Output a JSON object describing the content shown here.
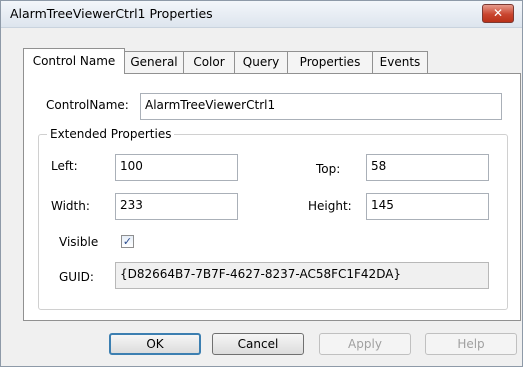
{
  "window": {
    "title": "AlarmTreeViewerCtrl1 Properties",
    "close_label": "✕"
  },
  "tabs": [
    {
      "label": "Control Name"
    },
    {
      "label": "General"
    },
    {
      "label": "Color"
    },
    {
      "label": "Query"
    },
    {
      "label": "Properties"
    },
    {
      "label": "Events"
    }
  ],
  "form": {
    "control_name_label": "ControlName:",
    "control_name_value": "AlarmTreeViewerCtrl1",
    "group_title": "Extended Properties",
    "left_label": "Left:",
    "left_value": "100",
    "top_label": "Top:",
    "top_value": "58",
    "width_label": "Width:",
    "width_value": "233",
    "height_label": "Height:",
    "height_value": "145",
    "visible_label": "Visible",
    "visible_checked": "✓",
    "guid_label": "GUID:",
    "guid_value": "{D82664B7-7B7F-4627-8237-AC58FC1F42DA}"
  },
  "buttons": {
    "ok": "OK",
    "cancel": "Cancel",
    "apply": "Apply",
    "help": "Help"
  }
}
